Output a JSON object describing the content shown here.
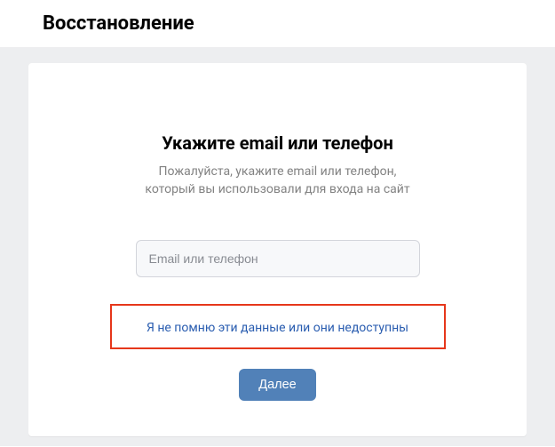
{
  "header": {
    "title": "Восстановление"
  },
  "card": {
    "title": "Укажите email или телефон",
    "subtitle_line1": "Пожалуйста, укажите email или телефон,",
    "subtitle_line2": "который вы использовали для входа на сайт",
    "input_placeholder": "Email или телефон",
    "forgot_link": "Я не помню эти данные или они недоступны",
    "next_button": "Далее"
  }
}
